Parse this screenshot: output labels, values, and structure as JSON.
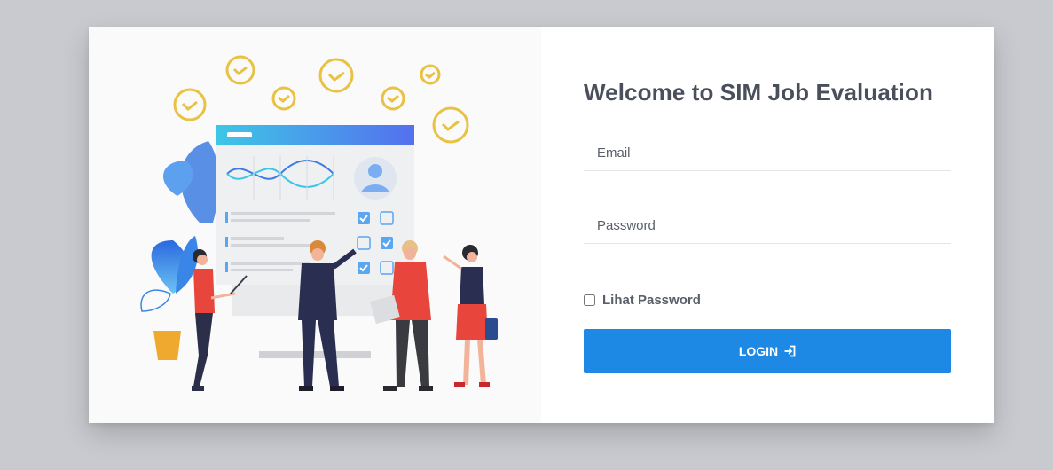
{
  "login": {
    "title": "Welcome to SIM Job Evaluation",
    "email_placeholder": "Email",
    "password_placeholder": "Password",
    "show_password_label": "Lihat Password",
    "show_password_checked": false,
    "button_label": "LOGIN",
    "button_icon": "sign-in-icon"
  },
  "colors": {
    "background": "#c8cacf",
    "button": "#1e88e5",
    "title": "#4a4f5c",
    "checkmark": "#e9c244"
  },
  "illustration": {
    "description_icon": "job-evaluation-illustration"
  }
}
